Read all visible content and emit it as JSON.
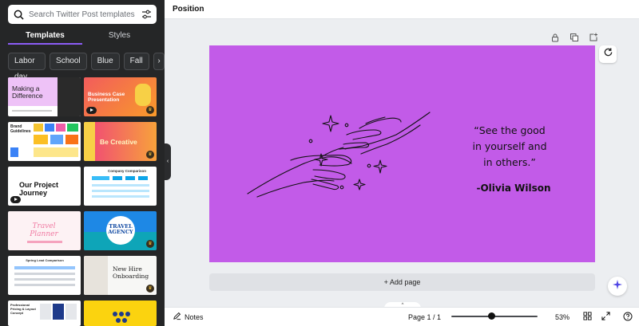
{
  "sidebar": {
    "search": {
      "placeholder": "Search Twitter Post templates",
      "value": ""
    },
    "tabs": [
      {
        "label": "Templates",
        "active": true
      },
      {
        "label": "Styles",
        "active": false
      }
    ],
    "chips": [
      "Labor day",
      "School",
      "Blue",
      "Fall"
    ],
    "thumbnails": {
      "t1_title": "Making a Difference",
      "t2_title": "Business Case Presentation",
      "t3_title": "Brand Guidelines",
      "t4_title": "Be Creative",
      "t5_title": "Our Project Journey",
      "t6_title": "Company Comparison",
      "t7_title": "Travel Planner",
      "t8_title": "TRAVEL AGENCY",
      "t9_title": "Spring Lead Comparison",
      "t10_title": "New Hire Onboarding",
      "t11_title": "Professional Pricing & Layout Concept"
    }
  },
  "topbar": {
    "label": "Position"
  },
  "canvas": {
    "background": "#c25be8",
    "quote_lines": [
      "“See the good",
      "in yourself and",
      "in others.”"
    ],
    "author": "-Olivia Wilson"
  },
  "add_page_label": "+ Add page",
  "bottombar": {
    "notes_label": "Notes",
    "page_indicator": "Page 1 / 1",
    "zoom": "53%",
    "zoom_fraction": 0.53
  },
  "colors": {
    "accent": "#8b5cf6",
    "sidebar_bg": "#252627",
    "canvas_bg": "#c25be8"
  },
  "icons": [
    "search-icon",
    "filter-icon",
    "chevron-right-icon",
    "lock-icon",
    "duplicate-icon",
    "add-page-icon",
    "refresh-icon",
    "magic-icon",
    "notes-icon",
    "grid-icon",
    "fullscreen-icon",
    "help-icon"
  ]
}
